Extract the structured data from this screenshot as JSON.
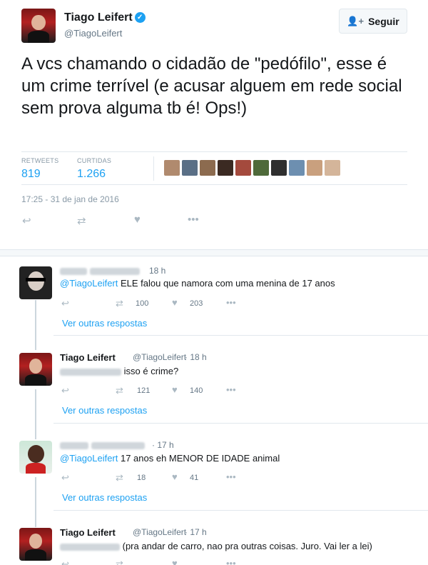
{
  "tweet": {
    "author_name": "Tiago Leifert",
    "author_handle": "@TiagoLeifert",
    "follow_label": "Seguir",
    "text": "A vcs chamando o cidadão de \"pedófilo\", esse é um crime terrível (e acusar alguem em rede social sem prova alguma tb é! Ops!)",
    "retweets_label": "RETWEETS",
    "retweets": "819",
    "likes_label": "CURTIDAS",
    "likes": "1.266",
    "timestamp": "17:25 - 31 de jan de 2016"
  },
  "replies": [
    {
      "time": "18 h",
      "mention": "@TiagoLeifert",
      "text": " ELE falou que namora com uma menina de 17 anos",
      "retweets": "100",
      "likes": "203",
      "more": "Ver outras respostas"
    },
    {
      "name": "Tiago Leifert",
      "handle": "@TiagoLeifert",
      "time": "· 18 h",
      "text": "isso é crime?",
      "retweets": "121",
      "likes": "140",
      "more": "Ver outras respostas"
    },
    {
      "time": "· 17 h",
      "mention": "@TiagoLeifert",
      "text": " 17 anos eh MENOR DE IDADE animal",
      "retweets": "18",
      "likes": "41",
      "more": "Ver outras respostas"
    },
    {
      "name": "Tiago Leifert",
      "handle": "@TiagoLeifert",
      "time": "· 17 h",
      "text": "(pra andar de carro, nao pra outras coisas. Juro. Vai ler a lei)",
      "retweets": "",
      "likes": ""
    }
  ],
  "colors": {
    "accent": "#1da1f2",
    "muted": "#657786",
    "liked_avatars": [
      "#b08a6e",
      "#5a6f86",
      "#8c6b4f",
      "#3b2a22",
      "#a44a3d",
      "#4f6a3a",
      "#2f2f2f",
      "#6d8fb0",
      "#c9a07e",
      "#d4b59a"
    ]
  }
}
